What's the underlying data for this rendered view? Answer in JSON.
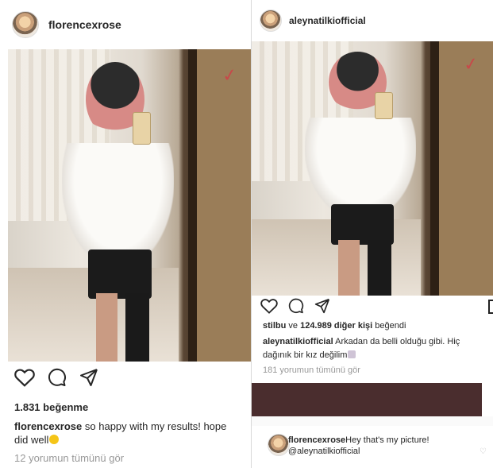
{
  "left_post": {
    "username": "florencexrose",
    "likes": "1.831 beğenme",
    "caption_user": "florencexrose",
    "caption_text": "so happy with my results! hope",
    "caption_cont": "did well",
    "comments_link": "12 yorumun tümünü gör"
  },
  "right_post": {
    "username": "aleynatilkiofficial",
    "likes_user": "stilbu",
    "likes_mid": " ve ",
    "likes_count": "124.989 diğer kişi",
    "likes_tail": " beğendi",
    "caption_user": "aleynatilkiofficial",
    "caption_text": "Arkadan da belli olduğu gibi. Hiç",
    "caption_cont": "dağınık bir kız değilim",
    "comments_link": "181 yorumun tümünü gör",
    "comment": {
      "user": "florencexrose",
      "text": "Hey that's my picture!",
      "mention": "@aleynatilkiofficial"
    }
  },
  "icons": [
    "heart-icon",
    "comment-icon",
    "share-icon"
  ],
  "colors": {
    "text": "#262626",
    "muted": "#999999",
    "redaction": "#4a2d2e"
  }
}
